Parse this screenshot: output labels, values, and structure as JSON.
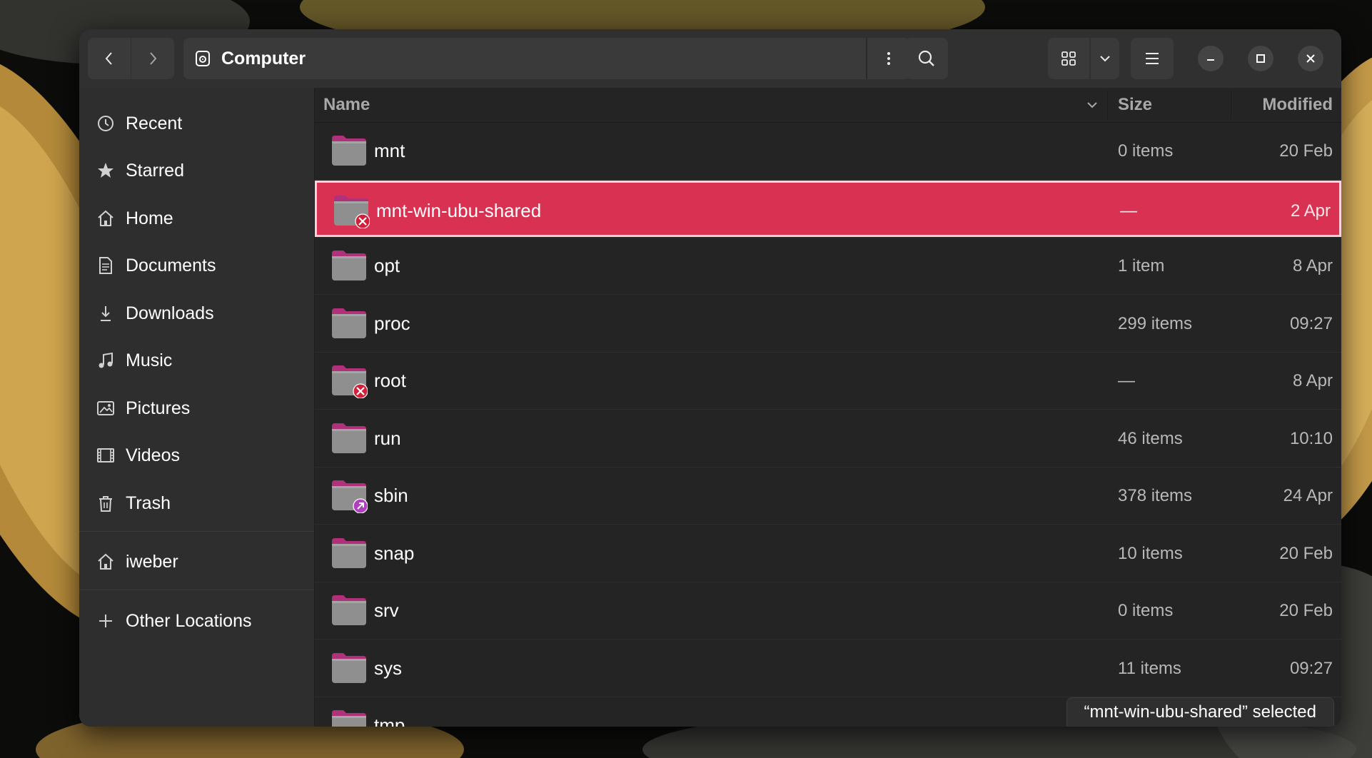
{
  "window": {
    "location": "Computer",
    "controls": {
      "minimize": "minimize-icon",
      "maximize": "maximize-icon",
      "close": "close-icon"
    }
  },
  "sidebar": {
    "items": [
      {
        "label": "Recent",
        "icon": "clock-icon"
      },
      {
        "label": "Starred",
        "icon": "star-icon"
      },
      {
        "label": "Home",
        "icon": "home-icon"
      },
      {
        "label": "Documents",
        "icon": "document-icon"
      },
      {
        "label": "Downloads",
        "icon": "download-icon"
      },
      {
        "label": "Music",
        "icon": "music-icon"
      },
      {
        "label": "Pictures",
        "icon": "picture-icon"
      },
      {
        "label": "Videos",
        "icon": "video-icon"
      },
      {
        "label": "Trash",
        "icon": "trash-icon"
      }
    ],
    "bookmarks": [
      {
        "label": "iweber",
        "icon": "home-icon"
      }
    ],
    "other_locations": {
      "label": "Other Locations",
      "icon": "plus-icon"
    }
  },
  "list": {
    "columns": {
      "name": "Name",
      "size": "Size",
      "modified": "Modified"
    },
    "rows": [
      {
        "name": "mnt",
        "size": "0 items",
        "modified": "20 Feb",
        "emblem": ""
      },
      {
        "name": "mnt-win-ubu-shared",
        "size": "—",
        "modified": "2 Apr",
        "emblem": "unreadable",
        "selected": true
      },
      {
        "name": "opt",
        "size": "1 item",
        "modified": "8 Apr",
        "emblem": ""
      },
      {
        "name": "proc",
        "size": "299 items",
        "modified": "09:27",
        "emblem": ""
      },
      {
        "name": "root",
        "size": "—",
        "modified": "8 Apr",
        "emblem": "unreadable"
      },
      {
        "name": "run",
        "size": "46 items",
        "modified": "10:10",
        "emblem": ""
      },
      {
        "name": "sbin",
        "size": "378 items",
        "modified": "24 Apr",
        "emblem": "symlink"
      },
      {
        "name": "snap",
        "size": "10 items",
        "modified": "20 Feb",
        "emblem": ""
      },
      {
        "name": "srv",
        "size": "0 items",
        "modified": "20 Feb",
        "emblem": ""
      },
      {
        "name": "sys",
        "size": "11 items",
        "modified": "09:27",
        "emblem": ""
      },
      {
        "name": "tmp",
        "size": "",
        "modified": "",
        "emblem": ""
      }
    ]
  },
  "status": {
    "text": "“mnt-win-ubu-shared” selected"
  },
  "colors": {
    "accent": "#d93151",
    "folder": "#8f8f8f",
    "folder_tab": "#b0307a",
    "emblem_error": "#d0203a",
    "emblem_link": "#b040c0"
  }
}
